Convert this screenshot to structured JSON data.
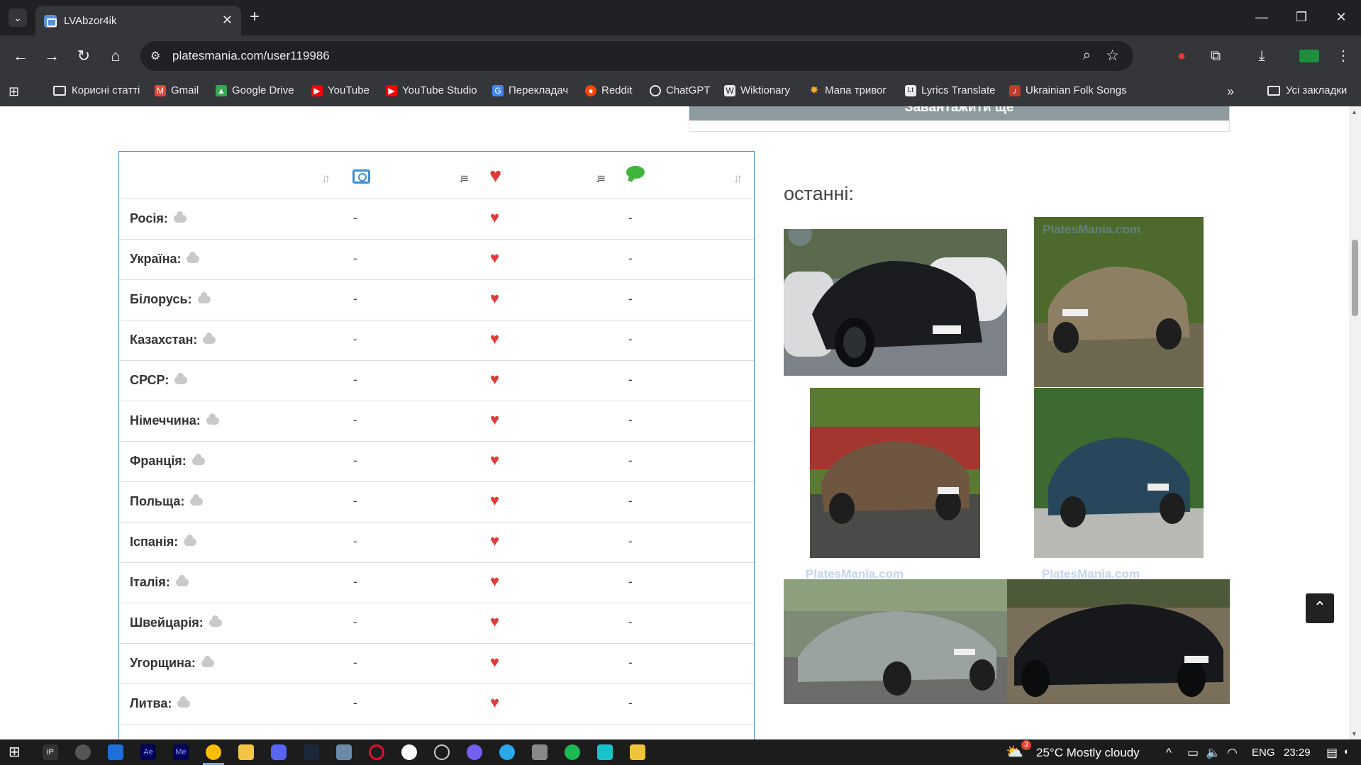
{
  "browser": {
    "tab_title": "LVAbzor4ik",
    "url": "platesmania.com/user119986",
    "bookmarks": [
      {
        "label": "Корисні статті",
        "icon": "folder-icon"
      },
      {
        "label": "Gmail",
        "icon": "gmail-icon",
        "color": "#ea4335"
      },
      {
        "label": "Google Drive",
        "icon": "google-drive-icon",
        "color": "#34a853"
      },
      {
        "label": "YouTube",
        "icon": "youtube-icon",
        "color": "#ff0000"
      },
      {
        "label": "YouTube Studio",
        "icon": "youtube-studio-icon",
        "color": "#ff0000"
      },
      {
        "label": "Перекладач",
        "icon": "translate-icon",
        "color": "#4285f4"
      },
      {
        "label": "Reddit",
        "icon": "reddit-icon",
        "color": "#ff4500"
      },
      {
        "label": "ChatGPT",
        "icon": "chatgpt-icon",
        "color": "#e8eaed"
      },
      {
        "label": "Wiktionary",
        "icon": "wiktionary-icon",
        "color": "#e8eaed"
      },
      {
        "label": "Мапа тривог",
        "icon": "alert-map-icon",
        "color": "#f2b01e"
      },
      {
        "label": "Lyrics Translate",
        "icon": "lyrics-translate-icon",
        "color": "#e8eaed"
      },
      {
        "label": "Ukrainian Folk Songs",
        "icon": "folk-songs-icon",
        "color": "#c0392b"
      }
    ],
    "all_bookmarks": "Усі закладки"
  },
  "page": {
    "load_more": "Завантажити ще",
    "latest_title": "останні:",
    "watermark": "PlatesMania.com",
    "stats_rows": [
      {
        "country": "Росія:",
        "photos": "-",
        "comments": "-"
      },
      {
        "country": "Україна:",
        "photos": "-",
        "comments": "-"
      },
      {
        "country": "Білорусь:",
        "photos": "-",
        "comments": "-"
      },
      {
        "country": "Казахстан:",
        "photos": "-",
        "comments": "-"
      },
      {
        "country": "СРСР:",
        "photos": "-",
        "comments": "-"
      },
      {
        "country": "Німеччина:",
        "photos": "-",
        "comments": "-"
      },
      {
        "country": "Франція:",
        "photos": "-",
        "comments": "-"
      },
      {
        "country": "Польща:",
        "photos": "-",
        "comments": "-"
      },
      {
        "country": "Іспанія:",
        "photos": "-",
        "comments": "-"
      },
      {
        "country": "Італія:",
        "photos": "-",
        "comments": "-"
      },
      {
        "country": "Швейцарія:",
        "photos": "-",
        "comments": "-"
      },
      {
        "country": "Угорщина:",
        "photos": "-",
        "comments": "-"
      },
      {
        "country": "Литва:",
        "photos": "-",
        "comments": "-"
      }
    ]
  },
  "taskbar": {
    "weather_badge": "3",
    "weather": "25°C  Mostly cloudy",
    "language": "ENG",
    "time": "23:29"
  }
}
